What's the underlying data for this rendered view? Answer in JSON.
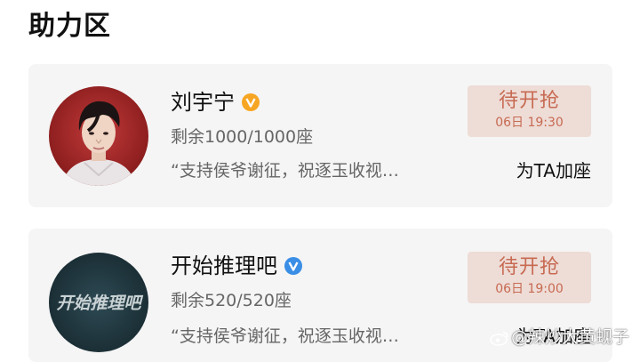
{
  "section_title": "助力区",
  "colors": {
    "card_bg": "#f5f5f5",
    "status_bg": "#eedcd6",
    "status_text": "#c76a52",
    "verify_orange": "#f6a623",
    "verify_blue": "#3a8ee6"
  },
  "cards": [
    {
      "avatar": "person-portrait-icon",
      "name": "刘宇宁",
      "verify_icon": "verified-orange-icon",
      "seats": "剩余1000/1000座",
      "quote": "“支持侯爷谢征，祝逐玉收视…",
      "status_label": "待开抢",
      "status_time": "06日 19:30",
      "action_label": "为TA加座"
    },
    {
      "avatar": "show-logo-avatar",
      "avatar_text": "开始推理吧",
      "name": "开始推理吧",
      "verify_icon": "verified-blue-icon",
      "seats": "剩余520/520座",
      "quote": "“支持侯爷谢征，祝逐玉收视…",
      "status_label": "待开抢",
      "status_time": "06日 19:00",
      "action_label": "为TA加座"
    }
  ],
  "watermark": "@辣炒大黄蚬子"
}
